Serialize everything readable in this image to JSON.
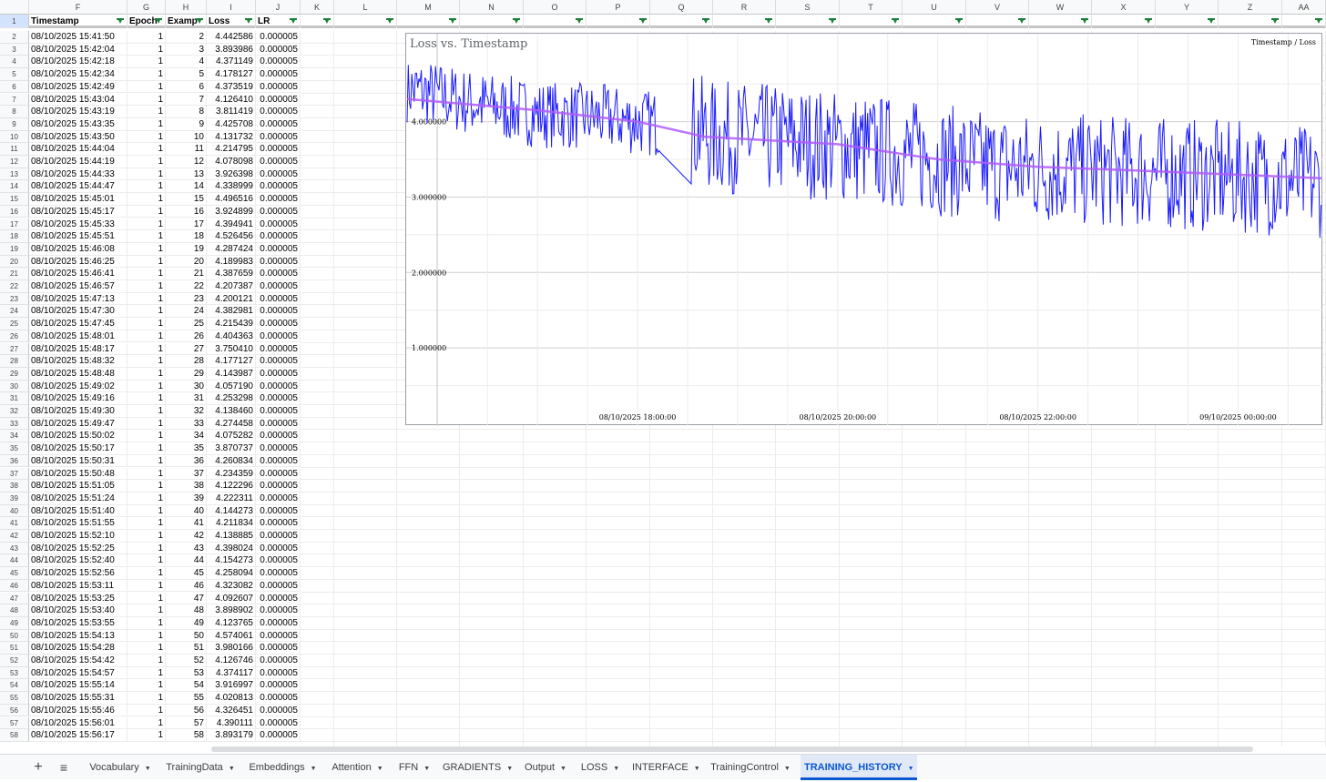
{
  "sheet": {
    "column_letters": [
      "F",
      "G",
      "H",
      "I",
      "J",
      "K",
      "L",
      "M",
      "N",
      "O",
      "P",
      "Q",
      "R",
      "S",
      "T",
      "U",
      "V",
      "W",
      "X",
      "Y",
      "Z",
      "AA"
    ],
    "header_row_number": "1",
    "headers": [
      "Timestamp",
      "Epoch",
      "Examp",
      "Loss",
      "LR"
    ],
    "rows": [
      {
        "n": "2",
        "ts": "08/10/2025 15:41:50",
        "epoch": "1",
        "ex": "2",
        "loss": "4.442586",
        "lr": "0.000005"
      },
      {
        "n": "3",
        "ts": "08/10/2025 15:42:04",
        "epoch": "1",
        "ex": "3",
        "loss": "3.893986",
        "lr": "0.000005"
      },
      {
        "n": "4",
        "ts": "08/10/2025 15:42:18",
        "epoch": "1",
        "ex": "4",
        "loss": "4.371149",
        "lr": "0.000005"
      },
      {
        "n": "5",
        "ts": "08/10/2025 15:42:34",
        "epoch": "1",
        "ex": "5",
        "loss": "4.178127",
        "lr": "0.000005"
      },
      {
        "n": "6",
        "ts": "08/10/2025 15:42:49",
        "epoch": "1",
        "ex": "6",
        "loss": "4.373519",
        "lr": "0.000005"
      },
      {
        "n": "7",
        "ts": "08/10/2025 15:43:04",
        "epoch": "1",
        "ex": "7",
        "loss": "4.126410",
        "lr": "0.000005"
      },
      {
        "n": "8",
        "ts": "08/10/2025 15:43:19",
        "epoch": "1",
        "ex": "8",
        "loss": "3.811419",
        "lr": "0.000005"
      },
      {
        "n": "9",
        "ts": "08/10/2025 15:43:35",
        "epoch": "1",
        "ex": "9",
        "loss": "4.425708",
        "lr": "0.000005"
      },
      {
        "n": "10",
        "ts": "08/10/2025 15:43:50",
        "epoch": "1",
        "ex": "10",
        "loss": "4.131732",
        "lr": "0.000005"
      },
      {
        "n": "11",
        "ts": "08/10/2025 15:44:04",
        "epoch": "1",
        "ex": "11",
        "loss": "4.214795",
        "lr": "0.000005"
      },
      {
        "n": "12",
        "ts": "08/10/2025 15:44:19",
        "epoch": "1",
        "ex": "12",
        "loss": "4.078098",
        "lr": "0.000005"
      },
      {
        "n": "13",
        "ts": "08/10/2025 15:44:33",
        "epoch": "1",
        "ex": "13",
        "loss": "3.926398",
        "lr": "0.000005"
      },
      {
        "n": "14",
        "ts": "08/10/2025 15:44:47",
        "epoch": "1",
        "ex": "14",
        "loss": "4.338999",
        "lr": "0.000005"
      },
      {
        "n": "15",
        "ts": "08/10/2025 15:45:01",
        "epoch": "1",
        "ex": "15",
        "loss": "4.496516",
        "lr": "0.000005"
      },
      {
        "n": "16",
        "ts": "08/10/2025 15:45:17",
        "epoch": "1",
        "ex": "16",
        "loss": "3.924899",
        "lr": "0.000005"
      },
      {
        "n": "17",
        "ts": "08/10/2025 15:45:33",
        "epoch": "1",
        "ex": "17",
        "loss": "4.394941",
        "lr": "0.000005"
      },
      {
        "n": "18",
        "ts": "08/10/2025 15:45:51",
        "epoch": "1",
        "ex": "18",
        "loss": "4.526456",
        "lr": "0.000005"
      },
      {
        "n": "19",
        "ts": "08/10/2025 15:46:08",
        "epoch": "1",
        "ex": "19",
        "loss": "4.287424",
        "lr": "0.000005"
      },
      {
        "n": "20",
        "ts": "08/10/2025 15:46:25",
        "epoch": "1",
        "ex": "20",
        "loss": "4.189983",
        "lr": "0.000005"
      },
      {
        "n": "21",
        "ts": "08/10/2025 15:46:41",
        "epoch": "1",
        "ex": "21",
        "loss": "4.387659",
        "lr": "0.000005"
      },
      {
        "n": "22",
        "ts": "08/10/2025 15:46:57",
        "epoch": "1",
        "ex": "22",
        "loss": "4.207387",
        "lr": "0.000005"
      },
      {
        "n": "23",
        "ts": "08/10/2025 15:47:13",
        "epoch": "1",
        "ex": "23",
        "loss": "4.200121",
        "lr": "0.000005"
      },
      {
        "n": "24",
        "ts": "08/10/2025 15:47:30",
        "epoch": "1",
        "ex": "24",
        "loss": "4.382981",
        "lr": "0.000005"
      },
      {
        "n": "25",
        "ts": "08/10/2025 15:47:45",
        "epoch": "1",
        "ex": "25",
        "loss": "4.215439",
        "lr": "0.000005"
      },
      {
        "n": "26",
        "ts": "08/10/2025 15:48:01",
        "epoch": "1",
        "ex": "26",
        "loss": "4.404363",
        "lr": "0.000005"
      },
      {
        "n": "27",
        "ts": "08/10/2025 15:48:17",
        "epoch": "1",
        "ex": "27",
        "loss": "3.750410",
        "lr": "0.000005"
      },
      {
        "n": "28",
        "ts": "08/10/2025 15:48:32",
        "epoch": "1",
        "ex": "28",
        "loss": "4.177127",
        "lr": "0.000005"
      },
      {
        "n": "29",
        "ts": "08/10/2025 15:48:48",
        "epoch": "1",
        "ex": "29",
        "loss": "4.143987",
        "lr": "0.000005"
      },
      {
        "n": "30",
        "ts": "08/10/2025 15:49:02",
        "epoch": "1",
        "ex": "30",
        "loss": "4.057190",
        "lr": "0.000005"
      },
      {
        "n": "31",
        "ts": "08/10/2025 15:49:16",
        "epoch": "1",
        "ex": "31",
        "loss": "4.253298",
        "lr": "0.000005"
      },
      {
        "n": "32",
        "ts": "08/10/2025 15:49:30",
        "epoch": "1",
        "ex": "32",
        "loss": "4.138460",
        "lr": "0.000005"
      },
      {
        "n": "33",
        "ts": "08/10/2025 15:49:47",
        "epoch": "1",
        "ex": "33",
        "loss": "4.274458",
        "lr": "0.000005"
      },
      {
        "n": "34",
        "ts": "08/10/2025 15:50:02",
        "epoch": "1",
        "ex": "34",
        "loss": "4.075282",
        "lr": "0.000005"
      },
      {
        "n": "35",
        "ts": "08/10/2025 15:50:17",
        "epoch": "1",
        "ex": "35",
        "loss": "3.870737",
        "lr": "0.000005"
      },
      {
        "n": "36",
        "ts": "08/10/2025 15:50:31",
        "epoch": "1",
        "ex": "36",
        "loss": "4.260834",
        "lr": "0.000005"
      },
      {
        "n": "37",
        "ts": "08/10/2025 15:50:48",
        "epoch": "1",
        "ex": "37",
        "loss": "4.234359",
        "lr": "0.000005"
      },
      {
        "n": "38",
        "ts": "08/10/2025 15:51:05",
        "epoch": "1",
        "ex": "38",
        "loss": "4.122296",
        "lr": "0.000005"
      },
      {
        "n": "39",
        "ts": "08/10/2025 15:51:24",
        "epoch": "1",
        "ex": "39",
        "loss": "4.222311",
        "lr": "0.000005"
      },
      {
        "n": "40",
        "ts": "08/10/2025 15:51:40",
        "epoch": "1",
        "ex": "40",
        "loss": "4.144273",
        "lr": "0.000005"
      },
      {
        "n": "41",
        "ts": "08/10/2025 15:51:55",
        "epoch": "1",
        "ex": "41",
        "loss": "4.211834",
        "lr": "0.000005"
      },
      {
        "n": "42",
        "ts": "08/10/2025 15:52:10",
        "epoch": "1",
        "ex": "42",
        "loss": "4.138885",
        "lr": "0.000005"
      },
      {
        "n": "43",
        "ts": "08/10/2025 15:52:25",
        "epoch": "1",
        "ex": "43",
        "loss": "4.398024",
        "lr": "0.000005"
      },
      {
        "n": "44",
        "ts": "08/10/2025 15:52:40",
        "epoch": "1",
        "ex": "44",
        "loss": "4.154273",
        "lr": "0.000005"
      },
      {
        "n": "45",
        "ts": "08/10/2025 15:52:56",
        "epoch": "1",
        "ex": "45",
        "loss": "4.258094",
        "lr": "0.000005"
      },
      {
        "n": "46",
        "ts": "08/10/2025 15:53:11",
        "epoch": "1",
        "ex": "46",
        "loss": "4.323082",
        "lr": "0.000005"
      },
      {
        "n": "47",
        "ts": "08/10/2025 15:53:25",
        "epoch": "1",
        "ex": "47",
        "loss": "4.092607",
        "lr": "0.000005"
      },
      {
        "n": "48",
        "ts": "08/10/2025 15:53:40",
        "epoch": "1",
        "ex": "48",
        "loss": "3.898902",
        "lr": "0.000005"
      },
      {
        "n": "49",
        "ts": "08/10/2025 15:53:55",
        "epoch": "1",
        "ex": "49",
        "loss": "4.123765",
        "lr": "0.000005"
      },
      {
        "n": "50",
        "ts": "08/10/2025 15:54:13",
        "epoch": "1",
        "ex": "50",
        "loss": "4.574061",
        "lr": "0.000005"
      },
      {
        "n": "51",
        "ts": "08/10/2025 15:54:28",
        "epoch": "1",
        "ex": "51",
        "loss": "3.980166",
        "lr": "0.000005"
      },
      {
        "n": "52",
        "ts": "08/10/2025 15:54:42",
        "epoch": "1",
        "ex": "52",
        "loss": "4.126746",
        "lr": "0.000005"
      },
      {
        "n": "53",
        "ts": "08/10/2025 15:54:57",
        "epoch": "1",
        "ex": "53",
        "loss": "4.374117",
        "lr": "0.000005"
      },
      {
        "n": "54",
        "ts": "08/10/2025 15:55:14",
        "epoch": "1",
        "ex": "54",
        "loss": "3.916997",
        "lr": "0.000005"
      },
      {
        "n": "55",
        "ts": "08/10/2025 15:55:31",
        "epoch": "1",
        "ex": "55",
        "loss": "4.020813",
        "lr": "0.000005"
      },
      {
        "n": "56",
        "ts": "08/10/2025 15:55:46",
        "epoch": "1",
        "ex": "56",
        "loss": "4.326451",
        "lr": "0.000005"
      },
      {
        "n": "57",
        "ts": "08/10/2025 15:56:01",
        "epoch": "1",
        "ex": "57",
        "loss": "4.390111",
        "lr": "0.000005"
      },
      {
        "n": "58",
        "ts": "08/10/2025 15:56:17",
        "epoch": "1",
        "ex": "58",
        "loss": "3.893179",
        "lr": "0.000005"
      }
    ]
  },
  "chart_data": {
    "type": "line",
    "title": "Loss vs. Timestamp",
    "legend": "Timestamp / Loss",
    "xlabel": "",
    "ylabel": "",
    "y_ticks": [
      "1.000000",
      "2.000000",
      "3.000000",
      "4.000000"
    ],
    "x_ticks": [
      "08/10/2025 18:00:00",
      "08/10/2025 20:00:00",
      "08/10/2025 22:00:00",
      "09/10/2025 00:00:00"
    ],
    "ylim": [
      0,
      4.9
    ],
    "xlim": [
      "08/10/2025 15:41:50",
      "09/10/2025 00:50:00"
    ],
    "series": [
      {
        "color": "#1a1aff",
        "points_approx": [
          [
            "08/10/2025 15:41:50",
            4.44
          ],
          [
            "08/10/2025 16:20:00",
            4.25
          ],
          [
            "08/10/2025 17:00:00",
            4.1
          ],
          [
            "08/10/2025 17:40:00",
            4.05
          ],
          [
            "08/10/2025 18:20:00",
            3.95
          ],
          [
            "08/10/2025 18:35:00",
            3.9
          ],
          [
            "08/10/2025 18:45:00",
            3.8
          ],
          [
            "08/10/2025 19:30:00",
            3.75
          ],
          [
            "08/10/2025 20:30:00",
            3.6
          ],
          [
            "08/10/2025 21:30:00",
            3.4
          ],
          [
            "08/10/2025 22:30:00",
            3.35
          ],
          [
            "08/10/2025 23:30:00",
            3.3
          ],
          [
            "09/10/2025 00:50:00",
            3.2
          ]
        ]
      },
      {
        "color": "#b05cff",
        "points_approx": [
          [
            "08/10/2025 15:41:50",
            4.3
          ],
          [
            "08/10/2025 17:00:00",
            4.15
          ],
          [
            "08/10/2025 18:00:00",
            4.0
          ],
          [
            "08/10/2025 18:40:00",
            3.8
          ],
          [
            "08/10/2025 20:00:00",
            3.7
          ],
          [
            "08/10/2025 21:00:00",
            3.5
          ],
          [
            "08/10/2025 22:00:00",
            3.4
          ],
          [
            "08/10/2025 23:00:00",
            3.35
          ],
          [
            "09/10/2025 00:50:00",
            3.25
          ]
        ]
      }
    ]
  },
  "tabs": {
    "add_icon": "plus-icon",
    "list_icon": "menu-icon",
    "items": [
      "Vocabulary",
      "TrainingData",
      "Embeddings",
      "Attention",
      "FFN",
      "GRADIENTS",
      "Output",
      "LOSS",
      "INTERFACE",
      "TrainingControl",
      "TRAINING_HISTORY"
    ],
    "active": "TRAINING_HISTORY"
  }
}
